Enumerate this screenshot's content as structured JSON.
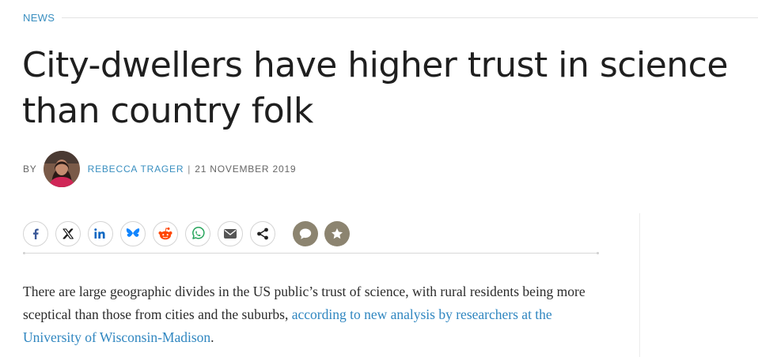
{
  "section": {
    "label": "NEWS"
  },
  "article": {
    "headline": "City-dwellers have higher trust in science than country folk",
    "byline": {
      "prefix": "BY",
      "author": "REBECCA TRAGER",
      "separator": "|",
      "date": "21 NOVEMBER 2019"
    },
    "body": {
      "text": "There are large geographic divides in the US public’s trust of science, with rural residents being more sceptical than those from cities and the suburbs, ",
      "link_text": "according to new analysis by researchers at the University of Wisconsin-Madison",
      "text_end": "."
    }
  },
  "share_buttons": [
    {
      "icon": "facebook-icon",
      "color": "#3b5998"
    },
    {
      "icon": "x-icon",
      "color": "#111111"
    },
    {
      "icon": "linkedin-icon",
      "color": "#0a66c2"
    },
    {
      "icon": "bluesky-icon",
      "color": "#1185fe"
    },
    {
      "icon": "reddit-icon",
      "color": "#ff4500"
    },
    {
      "icon": "whatsapp-icon",
      "color": "#25d366"
    },
    {
      "icon": "email-icon",
      "color": "#555555"
    },
    {
      "icon": "share-icon",
      "color": "#333333"
    }
  ],
  "action_buttons": [
    {
      "icon": "comment-icon",
      "color": "#8c8470"
    },
    {
      "icon": "star-icon",
      "color": "#8c8470"
    }
  ],
  "colors": {
    "link": "#3a8fc0",
    "headline": "#1f1f1f",
    "body": "#2b2b2b"
  }
}
